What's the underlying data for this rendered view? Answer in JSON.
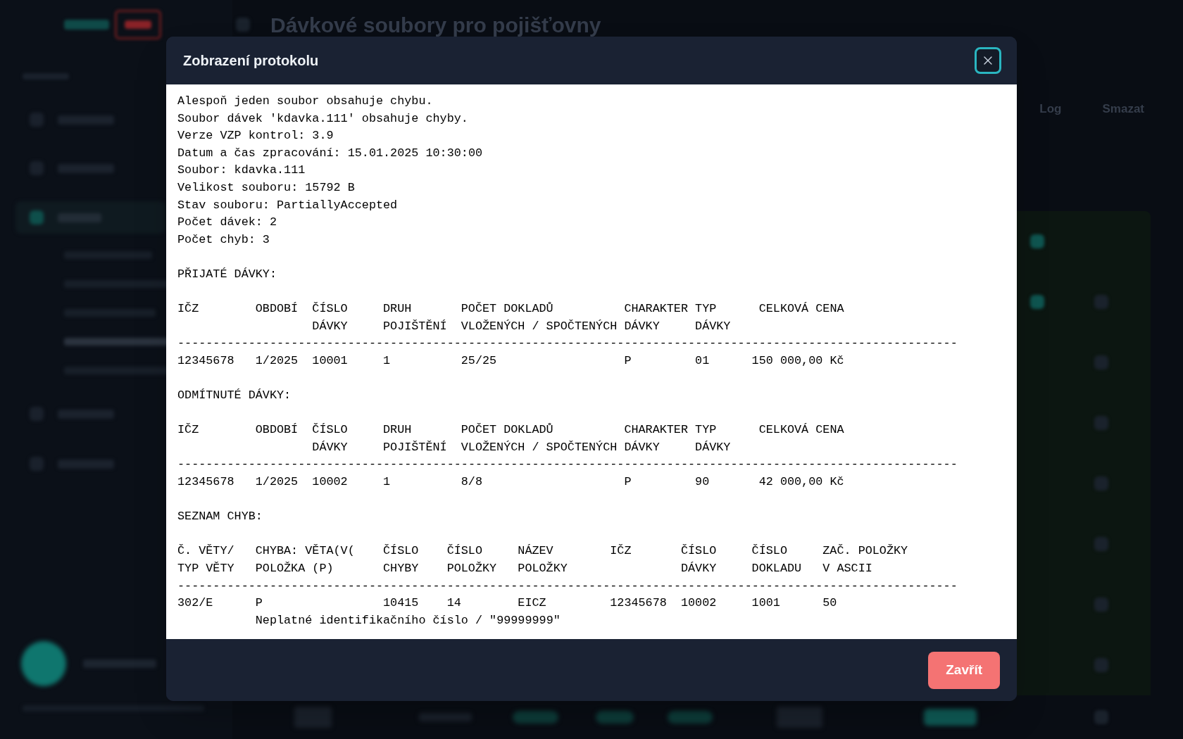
{
  "page": {
    "title": "Dávkové soubory pro pojišťovny",
    "actions": [
      "Log",
      "Smazat"
    ]
  },
  "dialog": {
    "title": "Zobrazení protokolu",
    "close_button": {
      "focused": true
    },
    "summary_lines": [
      "Alespoň jeden soubor obsahuje chybu.",
      "Soubor dávek 'kdavka.111' obsahuje chyby.",
      "Verze VZP kontrol: 3.9",
      "Datum a čas zpracování: 15.01.2025 10:30:00",
      "Soubor: kdavka.111",
      "Velikost souboru: 15792 B",
      "Stav souboru: PartiallyAccepted",
      "Počet dávek: 2",
      "Počet chyb: 3"
    ],
    "sections": [
      {
        "kind": "batches",
        "heading": "PŘIJATÉ DÁVKY:",
        "columns": [
          "IČZ",
          "OBDOBÍ",
          "ČÍSLO DÁVKY",
          "DRUH POJIŠTĚNÍ",
          "POČET DOKLADŮ VLOŽENÝCH / SPOČTENÝCH",
          "CHARAKTER DÁVKY",
          "TYP DÁVKY",
          "CELKOVÁ CENA"
        ],
        "separator": "--------------------------------------------------------------------------------------------------------------",
        "rows": [
          {
            "cells": [
              "12345678",
              "1/2025",
              "10001",
              "1",
              "25/25",
              "P",
              "01",
              "150 000,00 Kč"
            ]
          }
        ]
      },
      {
        "kind": "batches",
        "heading": "ODMÍTNUTÉ DÁVKY:",
        "columns": [
          "IČZ",
          "OBDOBÍ",
          "ČÍSLO DÁVKY",
          "DRUH POJIŠTĚNÍ",
          "POČET DOKLADŮ VLOŽENÝCH / SPOČTENÝCH",
          "CHARAKTER DÁVKY",
          "TYP DÁVKY",
          "CELKOVÁ CENA"
        ],
        "separator": "--------------------------------------------------------------------------------------------------------------",
        "rows": [
          {
            "cells": [
              "12345678",
              "1/2025",
              "10002",
              "1",
              "8/8",
              "P",
              "90",
              "42 000,00 Kč"
            ]
          }
        ]
      },
      {
        "kind": "errors",
        "heading": "SEZNAM CHYB:",
        "columns": [
          "Č. VĚTY/ TYP VĚTY",
          "CHYBA: VĚTA(V( POLOŽKA (P)",
          "ČÍSLO CHYBY",
          "ČÍSLO POLOŽKY",
          "NÁZEV POLOŽKY",
          "IČZ",
          "ČÍSLO DÁVKY",
          "ČÍSLO DOKLADU",
          "ZAČ. POLOŽKY V ASCII"
        ],
        "separator": "--------------------------------------------------------------------------------------------------------------",
        "rows": [
          {
            "cells": [
              "302/E",
              "P",
              "10415",
              "14",
              "EICZ",
              "12345678",
              "10002",
              "1001",
              "50"
            ],
            "note": "Neplatné identifikačního číslo / \"99999999\""
          }
        ]
      }
    ],
    "buttons": [
      {
        "label": "Zavřít",
        "kind": "primary"
      }
    ]
  }
}
